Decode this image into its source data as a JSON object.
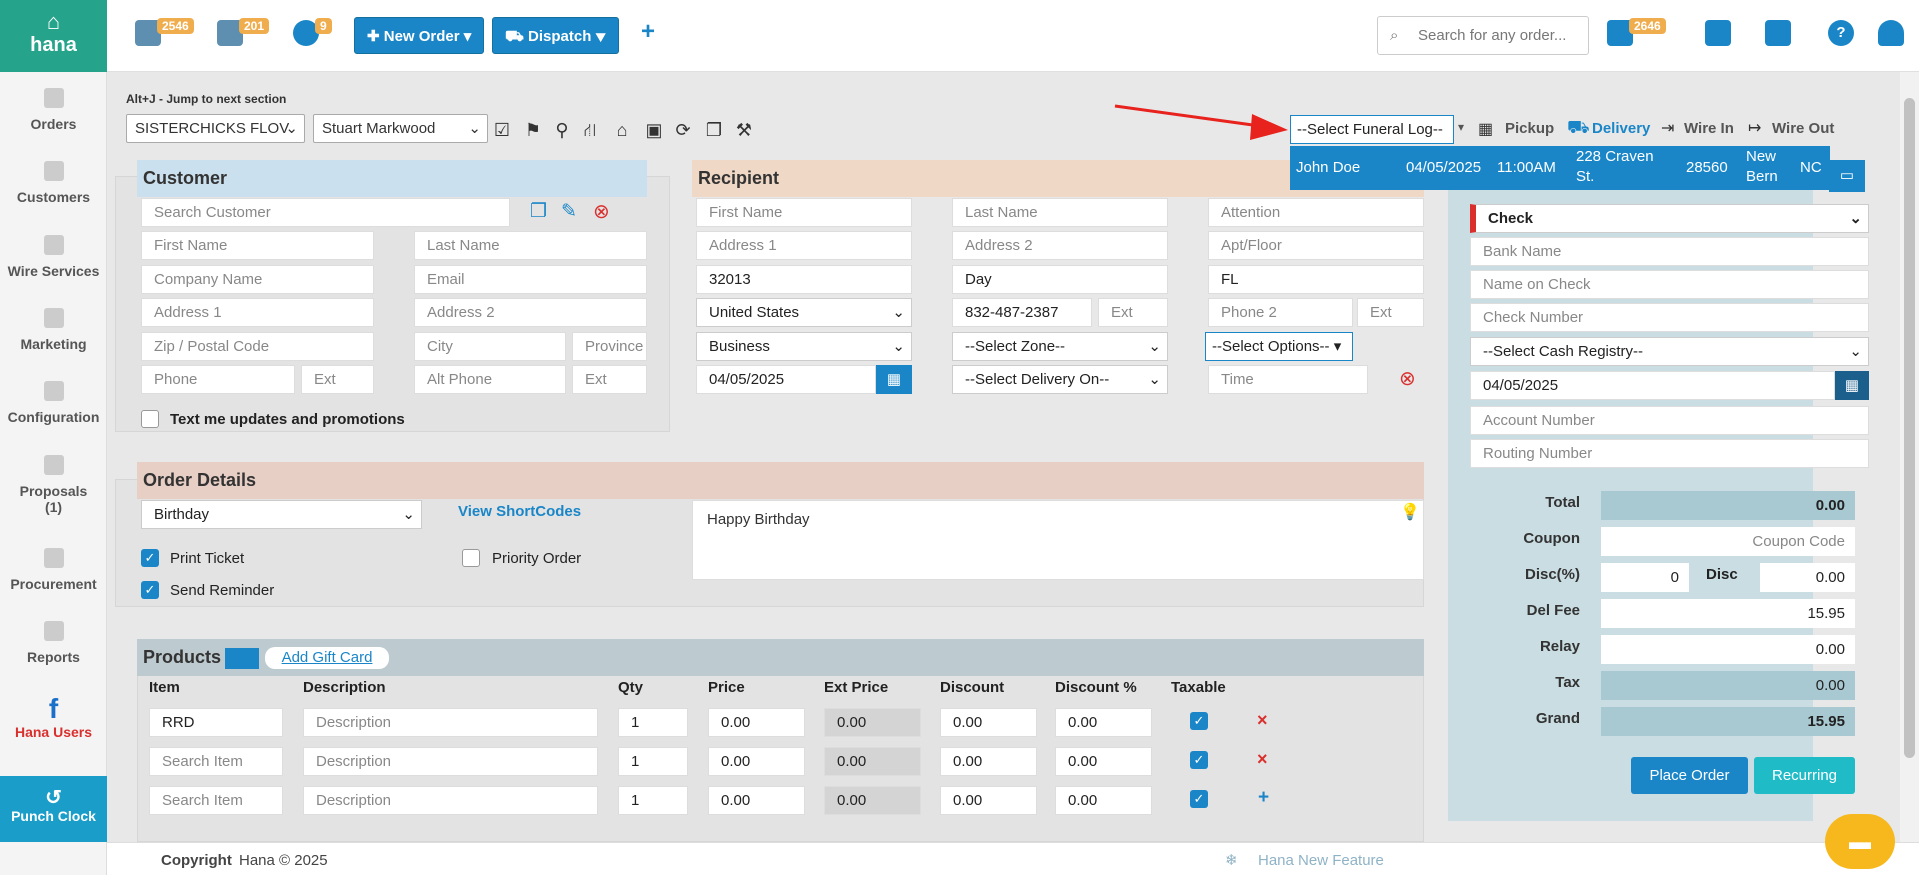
{
  "app": {
    "logo_text": "hana"
  },
  "sidebar": {
    "items": [
      {
        "label": "Orders",
        "icon": "orders-icon"
      },
      {
        "label": "Customers",
        "icon": "customers-icon"
      },
      {
        "label": "Wire Services",
        "icon": "wire-services-icon"
      },
      {
        "label": "Marketing",
        "icon": "marketing-icon"
      },
      {
        "label": "Configuration",
        "icon": "gear-icon"
      },
      {
        "label": "Proposals",
        "sub": "(1)",
        "icon": "proposals-icon"
      },
      {
        "label": "Procurement",
        "icon": "procurement-icon"
      },
      {
        "label": "Reports",
        "icon": "reports-icon"
      },
      {
        "label": "Hana Users",
        "icon": "facebook-icon"
      }
    ],
    "punch_clock": "Punch Clock"
  },
  "topbar": {
    "badges": [
      "2546",
      "201",
      "9"
    ],
    "new_order": "New Order",
    "dispatch": "Dispatch",
    "plus": "+",
    "search_placeholder": "Search for any order...",
    "mail_badge": "2646"
  },
  "toolbar": {
    "hint": "Alt+J - Jump to next section",
    "shop": "SISTERCHICKS FLOV",
    "employee": "Stuart Markwood",
    "funeral_select": "--Select Funeral Log--",
    "pickup": "Pickup",
    "delivery": "Delivery",
    "wire_in": "Wire In",
    "wire_out": "Wire Out"
  },
  "funeral_option": {
    "name": "John Doe",
    "date": "04/05/2025",
    "time": "11:00AM",
    "addr1": "228 Craven",
    "addr2": "St.",
    "zip": "28560",
    "city1": "New",
    "city2": "Bern",
    "state": "NC"
  },
  "customer": {
    "title": "Customer",
    "search_placeholder": "Search Customer",
    "first_name": "First Name",
    "last_name": "Last Name",
    "company": "Company Name",
    "email": "Email",
    "address1": "Address 1",
    "address2": "Address 2",
    "zip": "Zip / Postal Code",
    "city": "City",
    "province": "Province",
    "phone": "Phone",
    "ext": "Ext",
    "alt_phone": "Alt Phone",
    "ext2": "Ext",
    "sms_label": "Text me updates and promotions"
  },
  "recipient": {
    "title": "Recipient",
    "first_name": "First Name",
    "last_name": "Last Name",
    "attention": "Attention",
    "address1": "Address 1",
    "address2": "Address 2",
    "apt": "Apt/Floor",
    "zip_value": "32013",
    "city_value": "Day",
    "state_value": "FL",
    "country": "United States",
    "phone_value": "832-487-2387",
    "ext": "Ext",
    "phone2": "Phone 2",
    "ext2": "Ext",
    "type": "Business",
    "zone": "--Select Zone--",
    "options": "--Select Options--",
    "date": "04/05/2025",
    "delivery_on": "--Select Delivery On--",
    "time": "Time"
  },
  "order_details": {
    "title": "Order Details",
    "occasion": "Birthday",
    "view_shortcodes": "View ShortCodes",
    "message": "Happy Birthday",
    "print_ticket": "Print Ticket",
    "priority_order": "Priority Order",
    "send_reminder": "Send Reminder"
  },
  "products": {
    "title": "Products",
    "add_gift_card": "Add Gift Card",
    "headers": [
      "Item",
      "Description",
      "Qty",
      "Price",
      "Ext Price",
      "Discount",
      "Discount %",
      "Taxable"
    ],
    "rows": [
      {
        "item": "RRD",
        "item_is_value": true,
        "desc": "Description",
        "qty": "1",
        "price": "0.00",
        "ext": "0.00",
        "disc": "0.00",
        "discp": "0.00",
        "action": "×"
      },
      {
        "item": "Search Item",
        "item_is_value": false,
        "desc": "Description",
        "qty": "1",
        "price": "0.00",
        "ext": "0.00",
        "disc": "0.00",
        "discp": "0.00",
        "action": "×"
      },
      {
        "item": "Search Item",
        "item_is_value": false,
        "desc": "Description",
        "qty": "1",
        "price": "0.00",
        "ext": "0.00",
        "disc": "0.00",
        "discp": "0.00",
        "action": "+"
      }
    ]
  },
  "payment": {
    "method": "Check",
    "bank_name": "Bank Name",
    "name_on_check": "Name on Check",
    "check_number": "Check Number",
    "cash_registry": "--Select Cash Registry--",
    "date": "04/05/2025",
    "account_number": "Account Number",
    "routing_number": "Routing Number"
  },
  "totals": {
    "total_label": "Total",
    "total": "0.00",
    "coupon_label": "Coupon",
    "coupon_placeholder": "Coupon Code",
    "discp_label": "Disc(%)",
    "discp": "0",
    "disc_label": "Disc",
    "disc": "0.00",
    "delfee_label": "Del Fee",
    "delfee": "15.95",
    "relay_label": "Relay",
    "relay": "0.00",
    "tax_label": "Tax",
    "tax": "0.00",
    "grand_label": "Grand",
    "grand": "15.95",
    "place_order": "Place Order",
    "recurring": "Recurring"
  },
  "footer": {
    "copyright_label": "Copyright",
    "copyright": "Hana © 2025",
    "new_feature": "Hana New Feature"
  },
  "colors": {
    "brand": "#26a38b",
    "accent": "#1a86c8",
    "badge": "#f0ad4e",
    "danger": "#d9302e"
  }
}
